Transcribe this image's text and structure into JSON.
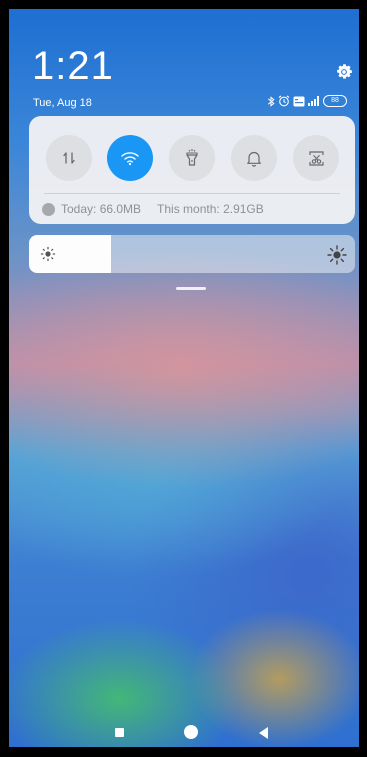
{
  "status": {
    "time": "1:21",
    "date": "Tue, Aug 18",
    "battery": "88",
    "icons": [
      "bluetooth-icon",
      "alarm-icon",
      "volte-icon",
      "signal-icon",
      "battery-icon"
    ]
  },
  "quick_settings": {
    "tiles": [
      {
        "name": "mobile-data",
        "icon": "data-transfer-icon",
        "active": false
      },
      {
        "name": "wifi",
        "icon": "wifi-icon",
        "active": true
      },
      {
        "name": "flashlight",
        "icon": "flashlight-icon",
        "active": false
      },
      {
        "name": "sound",
        "icon": "bell-icon",
        "active": false
      },
      {
        "name": "screenshot",
        "icon": "scissors-screenshot-icon",
        "active": false
      }
    ],
    "active_color": "#1a96f4",
    "data_usage": {
      "today": "Today: 66.0MB",
      "month": "This month: 2.91GB"
    }
  },
  "brightness": {
    "level": 0.25
  },
  "navbar": {
    "buttons": [
      "recents",
      "home",
      "back"
    ]
  }
}
